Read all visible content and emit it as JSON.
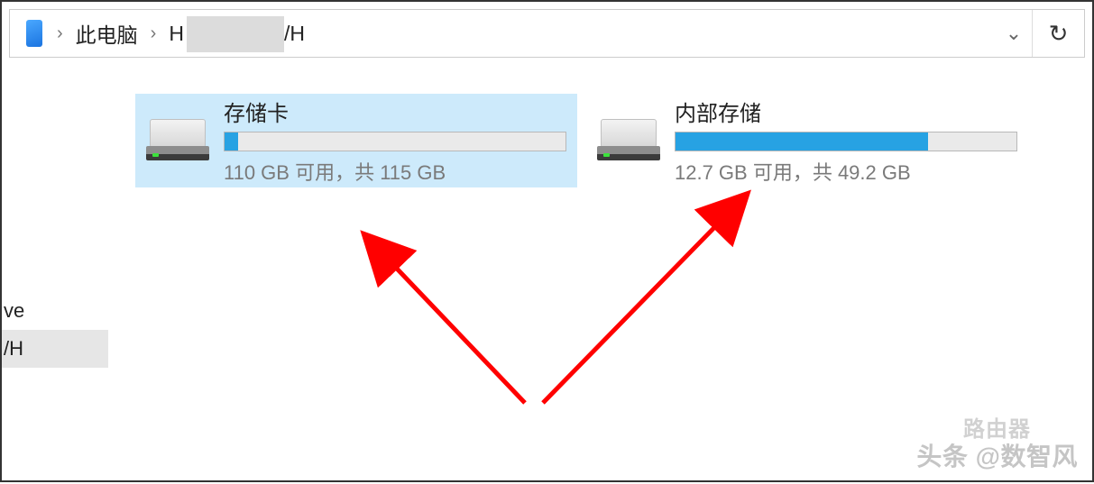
{
  "breadcrumb": {
    "root_label": "此电脑",
    "device_prefix": "H",
    "device_suffix": "/H"
  },
  "sidebar": {
    "items": [
      "ve",
      "/H"
    ],
    "selected_index": 1
  },
  "drives": [
    {
      "name": "存储卡",
      "free": "110 GB",
      "total": "115 GB",
      "subtitle": "110 GB 可用，共 115 GB",
      "used_percent": 4,
      "selected": true
    },
    {
      "name": "内部存储",
      "free": "12.7 GB",
      "total": "49.2 GB",
      "subtitle": "12.7 GB 可用，共 49.2 GB",
      "used_percent": 74,
      "selected": false
    }
  ],
  "watermark": {
    "line1": "路由器",
    "line2": "头条 @数智风"
  },
  "colors": {
    "accent": "#27a2e3",
    "selection_bg": "#cdeafb",
    "arrow": "#ff0000"
  }
}
